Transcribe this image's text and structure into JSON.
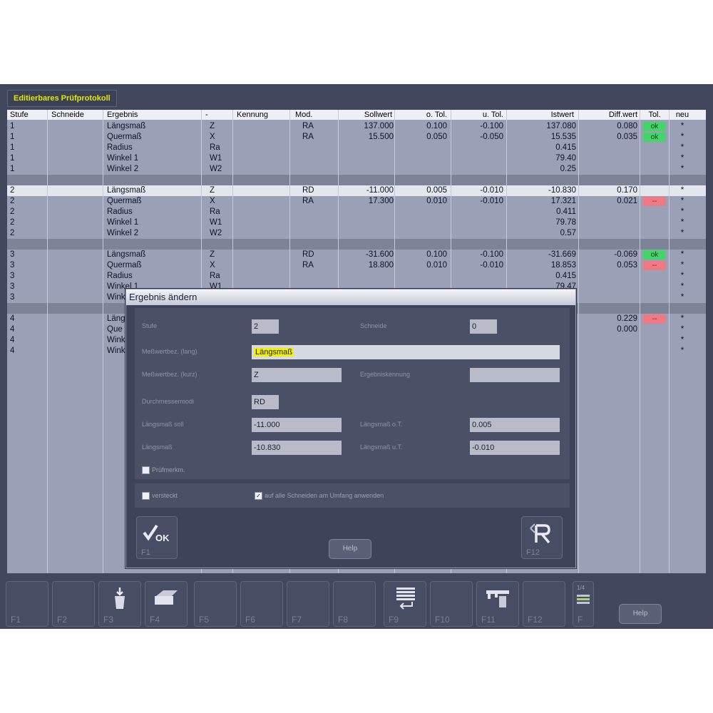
{
  "window": {
    "title": "Editierbares Prüfprotokoll"
  },
  "table": {
    "columns": [
      "Stufe",
      "Schneide",
      "Ergebnis",
      "-",
      "Kennung",
      "Mod.",
      "Sollwert",
      "o. Tol.",
      "u. Tol.",
      "Istwert",
      "Diff.wert",
      "Tol.",
      "neu"
    ],
    "rows": [
      {
        "stufe": "1",
        "ergebnis": "Längsmaß",
        "axis": "Z",
        "mod": "RA",
        "soll": "137.000",
        "otol": "0.100",
        "utol": "-0.100",
        "ist": "137.080",
        "diff": "0.080",
        "tol": "ok",
        "neu": "*"
      },
      {
        "stufe": "1",
        "ergebnis": "Quermaß",
        "axis": "X",
        "mod": "RA",
        "soll": "15.500",
        "otol": "0.050",
        "utol": "-0.050",
        "ist": "15.535",
        "diff": "0.035",
        "tol": "ok",
        "neu": "*"
      },
      {
        "stufe": "1",
        "ergebnis": "Radius",
        "axis": "Ra",
        "mod": "",
        "soll": "",
        "otol": "",
        "utol": "",
        "ist": "0.415",
        "diff": "",
        "tol": "",
        "neu": "*"
      },
      {
        "stufe": "1",
        "ergebnis": "Winkel 1",
        "axis": "W1",
        "mod": "",
        "soll": "",
        "otol": "",
        "utol": "",
        "ist": "79.40",
        "diff": "",
        "tol": "",
        "neu": "*"
      },
      {
        "stufe": "1",
        "ergebnis": "Winkel 2",
        "axis": "W2",
        "mod": "",
        "soll": "",
        "otol": "",
        "utol": "",
        "ist": "0.25",
        "diff": "",
        "tol": "",
        "neu": "*"
      },
      {
        "separator": true
      },
      {
        "stufe": "2",
        "ergebnis": "Längsmaß",
        "axis": "Z",
        "mod": "RD",
        "soll": "-11.000",
        "otol": "0.005",
        "utol": "-0.010",
        "ist": "-10.830",
        "diff": "0.170",
        "tol": "--",
        "neu": "*",
        "selected": true
      },
      {
        "stufe": "2",
        "ergebnis": "Quermaß",
        "axis": "X",
        "mod": "RA",
        "soll": "17.300",
        "otol": "0.010",
        "utol": "-0.010",
        "ist": "17.321",
        "diff": "0.021",
        "tol": "--",
        "neu": "*"
      },
      {
        "stufe": "2",
        "ergebnis": "Radius",
        "axis": "Ra",
        "mod": "",
        "soll": "",
        "otol": "",
        "utol": "",
        "ist": "0.411",
        "diff": "",
        "tol": "",
        "neu": "*"
      },
      {
        "stufe": "2",
        "ergebnis": "Winkel 1",
        "axis": "W1",
        "mod": "",
        "soll": "",
        "otol": "",
        "utol": "",
        "ist": "79.78",
        "diff": "",
        "tol": "",
        "neu": "*"
      },
      {
        "stufe": "2",
        "ergebnis": "Winkel 2",
        "axis": "W2",
        "mod": "",
        "soll": "",
        "otol": "",
        "utol": "",
        "ist": "0.57",
        "diff": "",
        "tol": "",
        "neu": "*"
      },
      {
        "separator": true
      },
      {
        "stufe": "3",
        "ergebnis": "Längsmaß",
        "axis": "Z",
        "mod": "RD",
        "soll": "-31.600",
        "otol": "0.100",
        "utol": "-0.100",
        "ist": "-31.669",
        "diff": "-0.069",
        "tol": "ok",
        "neu": "*"
      },
      {
        "stufe": "3",
        "ergebnis": "Quermaß",
        "axis": "X",
        "mod": "RA",
        "soll": "18.800",
        "otol": "0.010",
        "utol": "-0.010",
        "ist": "18.853",
        "diff": "0.053",
        "tol": "--",
        "neu": "*"
      },
      {
        "stufe": "3",
        "ergebnis": "Radius",
        "axis": "Ra",
        "mod": "",
        "soll": "",
        "otol": "",
        "utol": "",
        "ist": "0.415",
        "diff": "",
        "tol": "",
        "neu": "*"
      },
      {
        "stufe": "3",
        "ergebnis": "Winkel 1",
        "axis": "W1",
        "mod": "",
        "soll": "",
        "otol": "",
        "utol": "",
        "ist": "79.47",
        "diff": "",
        "tol": "",
        "neu": "*"
      },
      {
        "stufe": "3",
        "ergebnis": "Wink",
        "axis": "",
        "mod": "",
        "soll": "",
        "otol": "",
        "utol": "",
        "ist": "",
        "diff": "",
        "tol": "",
        "neu": "*"
      },
      {
        "separator": true
      },
      {
        "stufe": "4",
        "ergebnis": "Läng",
        "axis": "",
        "mod": "",
        "soll": "",
        "otol": "",
        "utol": "",
        "ist": "",
        "diff": "0.229",
        "tol": "--",
        "neu": "*"
      },
      {
        "stufe": "4",
        "ergebnis": "Que",
        "axis": "",
        "mod": "",
        "soll": "",
        "otol": "",
        "utol": "",
        "ist": "",
        "diff": "0.000",
        "tol": "",
        "neu": "*"
      },
      {
        "stufe": "4",
        "ergebnis": "Wink",
        "axis": "",
        "mod": "",
        "soll": "",
        "otol": "",
        "utol": "",
        "ist": "",
        "diff": "",
        "tol": "",
        "neu": "*"
      },
      {
        "stufe": "4",
        "ergebnis": "Wink",
        "axis": "",
        "mod": "",
        "soll": "",
        "otol": "",
        "utol": "",
        "ist": "",
        "diff": "",
        "tol": "",
        "neu": "*"
      }
    ]
  },
  "dialog": {
    "title": "Ergebnis ändern",
    "stufe_label": "Stufe",
    "stufe_value": "2",
    "schneide_label": "Schneide",
    "schneide_value": "0",
    "mess_long_label": "Meßwertbez. (lang)",
    "mess_long_value": "Längsmaß",
    "mess_kurz_label": "Meßwertbez. (kurz)",
    "mess_kurz_value": "Z",
    "kennung_label": "Ergebniskennung",
    "kennung_value": "",
    "durch_label": "Durchmessermodi",
    "durch_value": "RD",
    "soll_label": "Längsmaß soll",
    "soll_value": "-11.000",
    "ot_label": "Längsmaß o.T.",
    "ot_value": "0.005",
    "ist_label": "Längsmaß",
    "ist_value": "-10.830",
    "ut_label": "Längsmaß u.T.",
    "ut_value": "-0.010",
    "extra_checkbox_label": "Prüfmerkm.",
    "versteckt_label": "versteckt",
    "alle_label": "auf alle Schneiden am Umfang anwenden",
    "ok_fkey": "F1",
    "ok_text": "OK",
    "help_label": "Help",
    "reset_fkey": "F12"
  },
  "fkeys": [
    {
      "key": "F1",
      "icon": ""
    },
    {
      "key": "F2",
      "icon": ""
    },
    {
      "key": "F3",
      "icon": "trash-bin-icon"
    },
    {
      "key": "F4",
      "icon": "printer-icon"
    },
    {
      "key": "F5",
      "icon": ""
    },
    {
      "key": "F6",
      "icon": ""
    },
    {
      "key": "F7",
      "icon": ""
    },
    {
      "key": "F8",
      "icon": ""
    },
    {
      "key": "F9",
      "icon": "list-return-icon"
    },
    {
      "key": "F10",
      "icon": ""
    },
    {
      "key": "F11",
      "icon": "caliper-icon"
    },
    {
      "key": "F12",
      "icon": ""
    },
    {
      "key": "F",
      "icon": "page-toggle-icon",
      "page": "1/4"
    }
  ],
  "bottom_help": "Help",
  "colors": {
    "tol_ok": "#44d46a",
    "tol_bad": "#f07a84",
    "title_accent": "#e6e600"
  }
}
